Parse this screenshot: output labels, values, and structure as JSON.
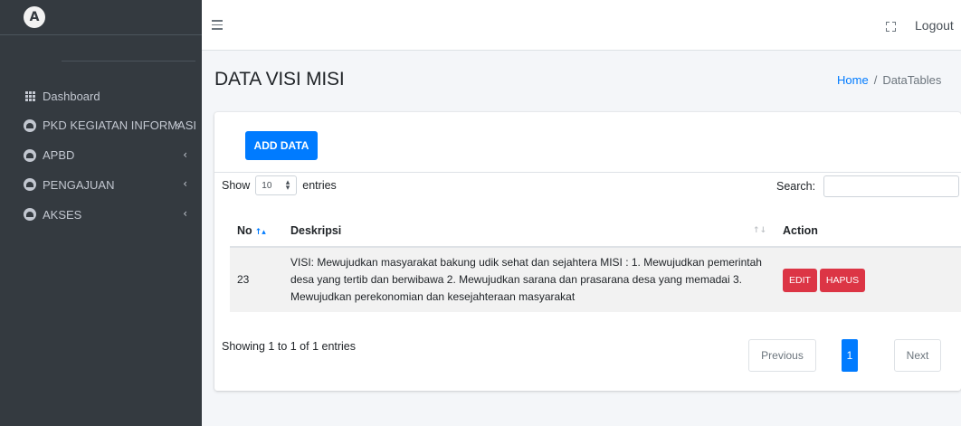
{
  "brand": {
    "logo_letter": "A"
  },
  "sidebar": {
    "items": [
      {
        "label": "Dashboard",
        "icon": "grid-icon",
        "has_chevron": false
      },
      {
        "label": "PKD KEGIATAN INFORMASI",
        "icon": "gauge-icon",
        "has_chevron": true
      },
      {
        "label": "APBD",
        "icon": "gauge-icon",
        "has_chevron": true
      },
      {
        "label": "PENGAJUAN",
        "icon": "gauge-icon",
        "has_chevron": true
      },
      {
        "label": "AKSES",
        "icon": "gauge-icon",
        "has_chevron": true
      }
    ],
    "chevron": "‹"
  },
  "topnav": {
    "logout": "Logout"
  },
  "header": {
    "title": "DATA VISI MISI",
    "breadcrumb": {
      "home": "Home",
      "separator": "/",
      "current": "DataTables"
    }
  },
  "card": {
    "add_button": "ADD DATA",
    "length": {
      "before": "Show",
      "value": "10",
      "after": "entries"
    },
    "search": {
      "label": "Search:",
      "value": ""
    },
    "table": {
      "columns": [
        "No",
        "Deskripsi",
        "Action"
      ],
      "rows": [
        {
          "no": "23",
          "deskripsi": "VISI: Mewujudkan masyarakat bakung udik sehat dan sejahtera MISI : 1. Mewujudkan pemerintah desa yang tertib dan berwibawa 2. Mewujudkan sarana dan prasarana desa yang memadai 3. Mewujudkan perekonomian dan kesejahteraan masyarakat",
          "edit": "EDIT",
          "hapus": "HAPUS"
        }
      ]
    },
    "info": "Showing 1 to 1 of 1 entries",
    "pagination": {
      "previous": "Previous",
      "current": "1",
      "next": "Next"
    }
  },
  "colors": {
    "sidebar_bg": "#343a40",
    "primary": "#007bff",
    "danger": "#dc3545",
    "content_bg": "#f4f6f9"
  }
}
